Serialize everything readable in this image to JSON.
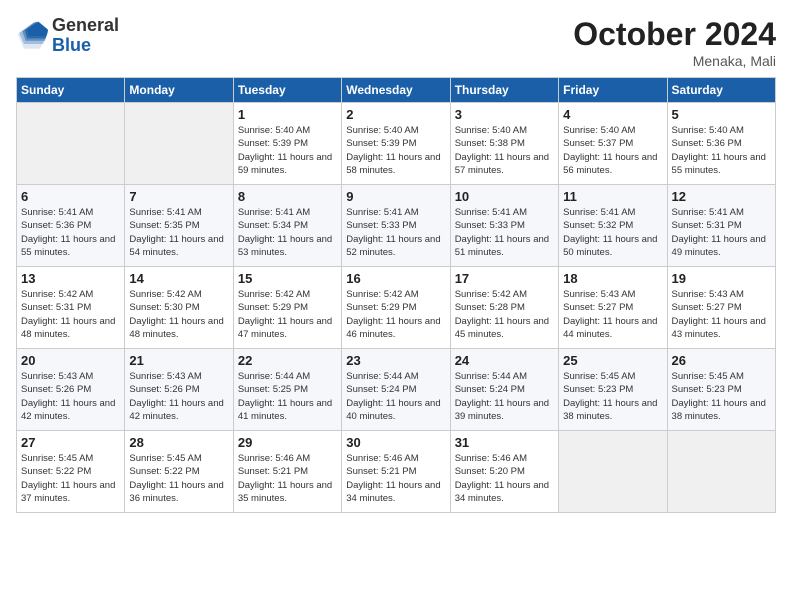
{
  "logo": {
    "line1": "General",
    "line2": "Blue"
  },
  "title": "October 2024",
  "subtitle": "Menaka, Mali",
  "days_header": [
    "Sunday",
    "Monday",
    "Tuesday",
    "Wednesday",
    "Thursday",
    "Friday",
    "Saturday"
  ],
  "weeks": [
    [
      {
        "day": "",
        "info": ""
      },
      {
        "day": "",
        "info": ""
      },
      {
        "day": "1",
        "info": "Sunrise: 5:40 AM\nSunset: 5:39 PM\nDaylight: 11 hours and 59 minutes."
      },
      {
        "day": "2",
        "info": "Sunrise: 5:40 AM\nSunset: 5:39 PM\nDaylight: 11 hours and 58 minutes."
      },
      {
        "day": "3",
        "info": "Sunrise: 5:40 AM\nSunset: 5:38 PM\nDaylight: 11 hours and 57 minutes."
      },
      {
        "day": "4",
        "info": "Sunrise: 5:40 AM\nSunset: 5:37 PM\nDaylight: 11 hours and 56 minutes."
      },
      {
        "day": "5",
        "info": "Sunrise: 5:40 AM\nSunset: 5:36 PM\nDaylight: 11 hours and 55 minutes."
      }
    ],
    [
      {
        "day": "6",
        "info": "Sunrise: 5:41 AM\nSunset: 5:36 PM\nDaylight: 11 hours and 55 minutes."
      },
      {
        "day": "7",
        "info": "Sunrise: 5:41 AM\nSunset: 5:35 PM\nDaylight: 11 hours and 54 minutes."
      },
      {
        "day": "8",
        "info": "Sunrise: 5:41 AM\nSunset: 5:34 PM\nDaylight: 11 hours and 53 minutes."
      },
      {
        "day": "9",
        "info": "Sunrise: 5:41 AM\nSunset: 5:33 PM\nDaylight: 11 hours and 52 minutes."
      },
      {
        "day": "10",
        "info": "Sunrise: 5:41 AM\nSunset: 5:33 PM\nDaylight: 11 hours and 51 minutes."
      },
      {
        "day": "11",
        "info": "Sunrise: 5:41 AM\nSunset: 5:32 PM\nDaylight: 11 hours and 50 minutes."
      },
      {
        "day": "12",
        "info": "Sunrise: 5:41 AM\nSunset: 5:31 PM\nDaylight: 11 hours and 49 minutes."
      }
    ],
    [
      {
        "day": "13",
        "info": "Sunrise: 5:42 AM\nSunset: 5:31 PM\nDaylight: 11 hours and 48 minutes."
      },
      {
        "day": "14",
        "info": "Sunrise: 5:42 AM\nSunset: 5:30 PM\nDaylight: 11 hours and 48 minutes."
      },
      {
        "day": "15",
        "info": "Sunrise: 5:42 AM\nSunset: 5:29 PM\nDaylight: 11 hours and 47 minutes."
      },
      {
        "day": "16",
        "info": "Sunrise: 5:42 AM\nSunset: 5:29 PM\nDaylight: 11 hours and 46 minutes."
      },
      {
        "day": "17",
        "info": "Sunrise: 5:42 AM\nSunset: 5:28 PM\nDaylight: 11 hours and 45 minutes."
      },
      {
        "day": "18",
        "info": "Sunrise: 5:43 AM\nSunset: 5:27 PM\nDaylight: 11 hours and 44 minutes."
      },
      {
        "day": "19",
        "info": "Sunrise: 5:43 AM\nSunset: 5:27 PM\nDaylight: 11 hours and 43 minutes."
      }
    ],
    [
      {
        "day": "20",
        "info": "Sunrise: 5:43 AM\nSunset: 5:26 PM\nDaylight: 11 hours and 42 minutes."
      },
      {
        "day": "21",
        "info": "Sunrise: 5:43 AM\nSunset: 5:26 PM\nDaylight: 11 hours and 42 minutes."
      },
      {
        "day": "22",
        "info": "Sunrise: 5:44 AM\nSunset: 5:25 PM\nDaylight: 11 hours and 41 minutes."
      },
      {
        "day": "23",
        "info": "Sunrise: 5:44 AM\nSunset: 5:24 PM\nDaylight: 11 hours and 40 minutes."
      },
      {
        "day": "24",
        "info": "Sunrise: 5:44 AM\nSunset: 5:24 PM\nDaylight: 11 hours and 39 minutes."
      },
      {
        "day": "25",
        "info": "Sunrise: 5:45 AM\nSunset: 5:23 PM\nDaylight: 11 hours and 38 minutes."
      },
      {
        "day": "26",
        "info": "Sunrise: 5:45 AM\nSunset: 5:23 PM\nDaylight: 11 hours and 38 minutes."
      }
    ],
    [
      {
        "day": "27",
        "info": "Sunrise: 5:45 AM\nSunset: 5:22 PM\nDaylight: 11 hours and 37 minutes."
      },
      {
        "day": "28",
        "info": "Sunrise: 5:45 AM\nSunset: 5:22 PM\nDaylight: 11 hours and 36 minutes."
      },
      {
        "day": "29",
        "info": "Sunrise: 5:46 AM\nSunset: 5:21 PM\nDaylight: 11 hours and 35 minutes."
      },
      {
        "day": "30",
        "info": "Sunrise: 5:46 AM\nSunset: 5:21 PM\nDaylight: 11 hours and 34 minutes."
      },
      {
        "day": "31",
        "info": "Sunrise: 5:46 AM\nSunset: 5:20 PM\nDaylight: 11 hours and 34 minutes."
      },
      {
        "day": "",
        "info": ""
      },
      {
        "day": "",
        "info": ""
      }
    ]
  ]
}
